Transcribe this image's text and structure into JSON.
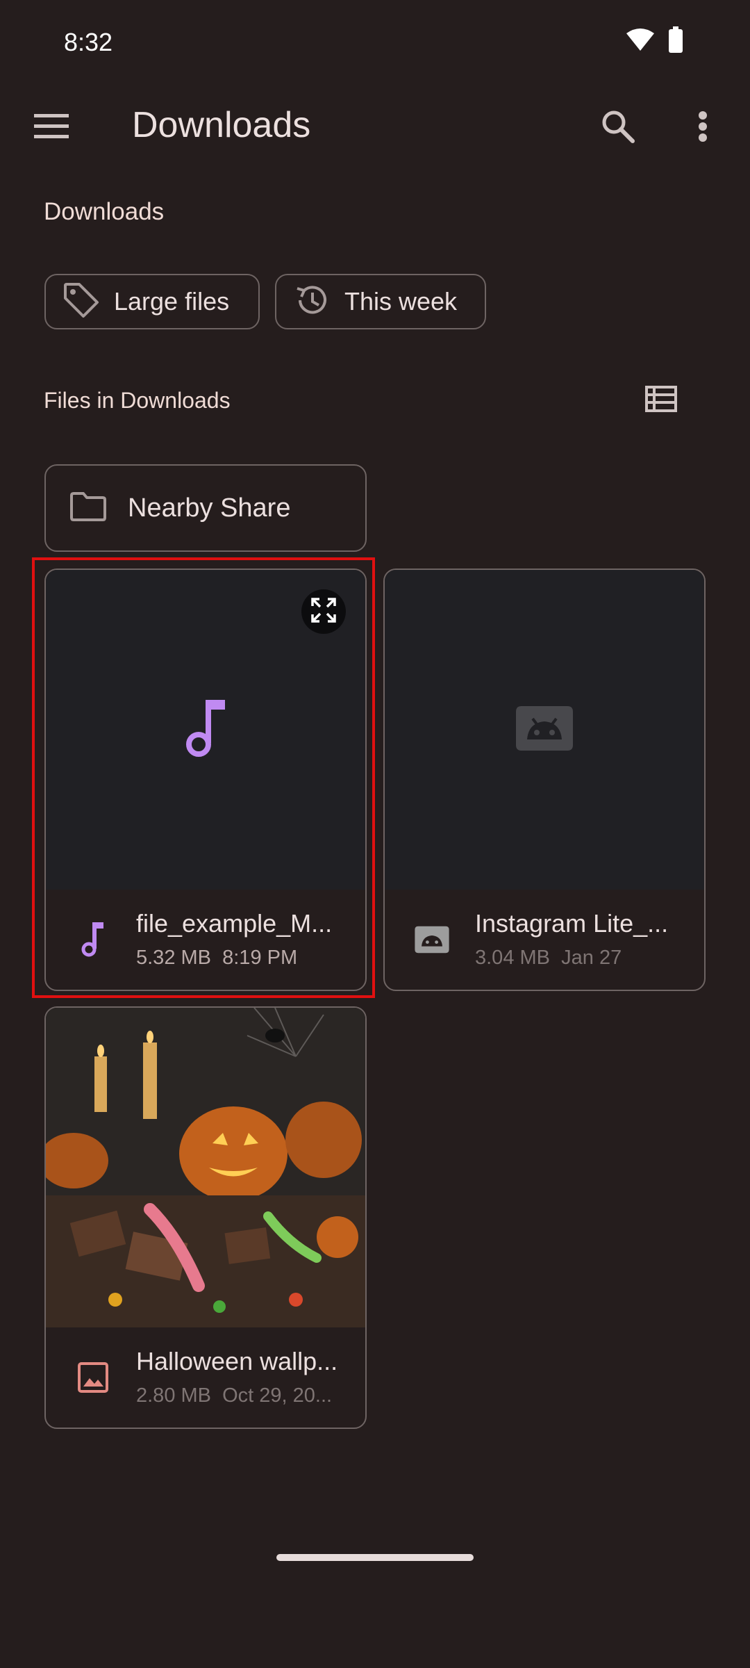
{
  "status": {
    "time": "8:32"
  },
  "app_bar": {
    "title": "Downloads"
  },
  "section_title": "Downloads",
  "chips": [
    {
      "label": "Large files",
      "icon": "tag-icon"
    },
    {
      "label": "This week",
      "icon": "history-icon"
    }
  ],
  "files_header": "Files in Downloads",
  "folders": [
    {
      "label": "Nearby Share",
      "icon": "folder-icon"
    }
  ],
  "files": [
    {
      "name": "file_example_M...",
      "size": "5.32 MB",
      "date": "8:19 PM",
      "type": "audio",
      "icon_color": "#c08af2"
    },
    {
      "name": "Instagram Lite_...",
      "size": "3.04 MB",
      "date": "Jan 27",
      "type": "apk",
      "icon_color": "#9d9d9d"
    },
    {
      "name": "Halloween wallp...",
      "size": "2.80 MB",
      "date": "Oct 29, 20...",
      "type": "image",
      "icon_color": "#e38a82"
    }
  ],
  "colors": {
    "background": "#251d1d",
    "outline": "#6e6463",
    "selection": "#e01010",
    "audio_accent": "#c08af2"
  }
}
